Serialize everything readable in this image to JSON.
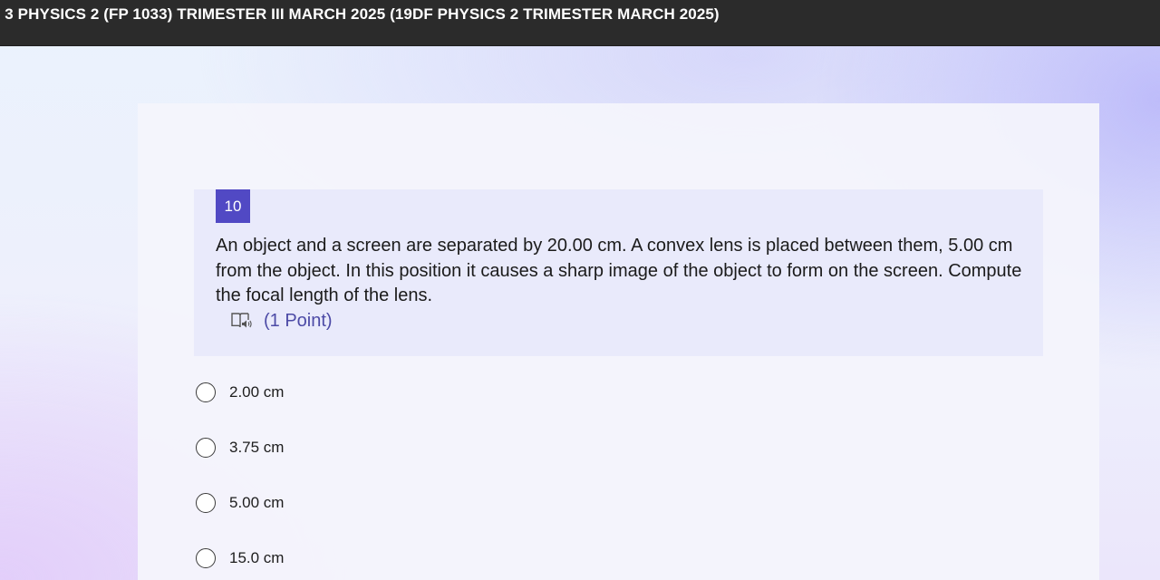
{
  "header": {
    "title": "Z 3 PHYSICS 2 (FP 1033) TRIMESTER III MARCH 2025 (19DF PHYSICS 2 TRIMESTER MARCH 2025)"
  },
  "question": {
    "number": "10",
    "text": "An object and a screen are separated by 20.00 cm. A convex lens is placed between them, 5.00 cm from the object. In this position it causes a sharp image of the object to form on the screen. Compute the focal length of the lens.",
    "points": "(1 Point)",
    "reader_icon": "immersive-reader-icon"
  },
  "options": [
    {
      "label": "2.00 cm",
      "selected": false
    },
    {
      "label": "3.75 cm",
      "selected": false
    },
    {
      "label": "5.00 cm",
      "selected": false
    },
    {
      "label": "15.0 cm",
      "selected": false
    }
  ],
  "colors": {
    "accent": "#5149c4",
    "points_text": "#4c4aa6",
    "topbar": "#2b2b2b"
  }
}
